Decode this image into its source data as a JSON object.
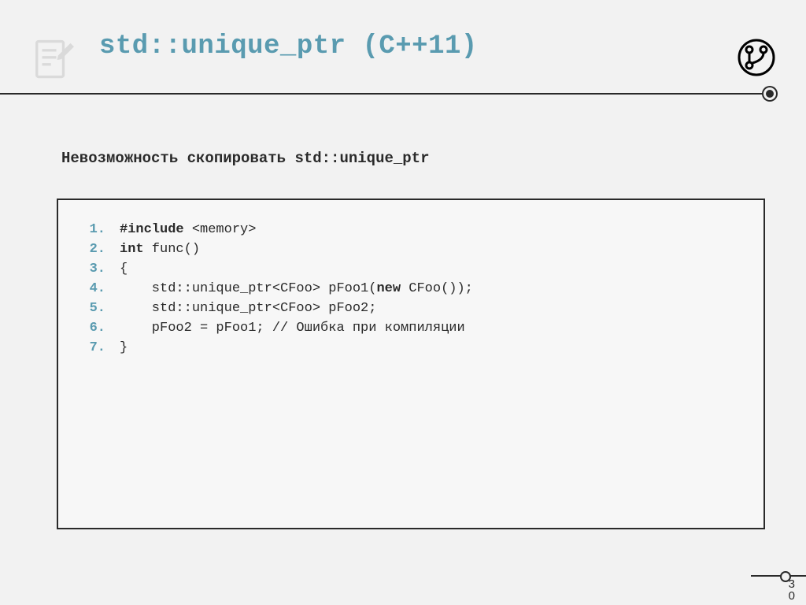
{
  "title": "std::unique_ptr (C++11)",
  "subtitle": "Невозможность скопировать std::unique_ptr",
  "code": {
    "lines": [
      {
        "n": "1.",
        "pre": "",
        "kw": "#include",
        "post": " <memory>"
      },
      {
        "n": "2.",
        "pre": "",
        "kw": "int",
        "post": " func()"
      },
      {
        "n": "3.",
        "pre": "{",
        "kw": "",
        "post": ""
      },
      {
        "n": "4.",
        "pre": "    std::unique_ptr<CFoo> pFoo1(",
        "kw": "new",
        "post": " CFoo());"
      },
      {
        "n": "5.",
        "pre": "    std::unique_ptr<CFoo> pFoo2;",
        "kw": "",
        "post": ""
      },
      {
        "n": "6.",
        "pre": "    pFoo2 = pFoo1; // Ошибка при компиляции",
        "kw": "",
        "post": ""
      },
      {
        "n": "7.",
        "pre": "}",
        "kw": "",
        "post": ""
      }
    ]
  },
  "page": {
    "a": "3",
    "b": "0"
  }
}
